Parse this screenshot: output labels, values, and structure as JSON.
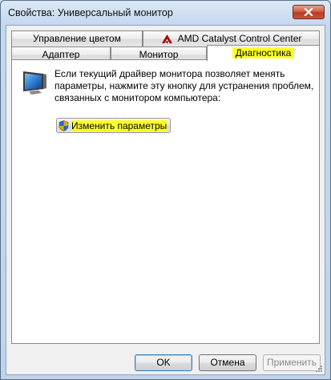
{
  "window": {
    "title": "Свойства: Универсальный монитор"
  },
  "tabs": {
    "row_back": [
      {
        "label": "Управление цветом"
      },
      {
        "label": "AMD Catalyst Control Center"
      }
    ],
    "row_front": [
      {
        "label": "Адаптер"
      },
      {
        "label": "Монитор"
      },
      {
        "label": "Диагностика",
        "active": true
      }
    ]
  },
  "panel": {
    "description": "Если текущий драйвер монитора позволяет менять параметры, нажмите эту кнопку для устранения проблем, связанных с монитором компьютера:",
    "change_button_label": "Изменить параметры"
  },
  "footer": {
    "ok_label": "OK",
    "cancel_label": "Отмена",
    "apply_label": "Применить"
  },
  "colors": {
    "highlight": "#ffff2a",
    "close_button": "#c9543a"
  },
  "icons": {
    "close": "close-icon",
    "amd": "amd-logo-icon",
    "monitor": "monitor-icon",
    "shield": "uac-shield-icon"
  }
}
